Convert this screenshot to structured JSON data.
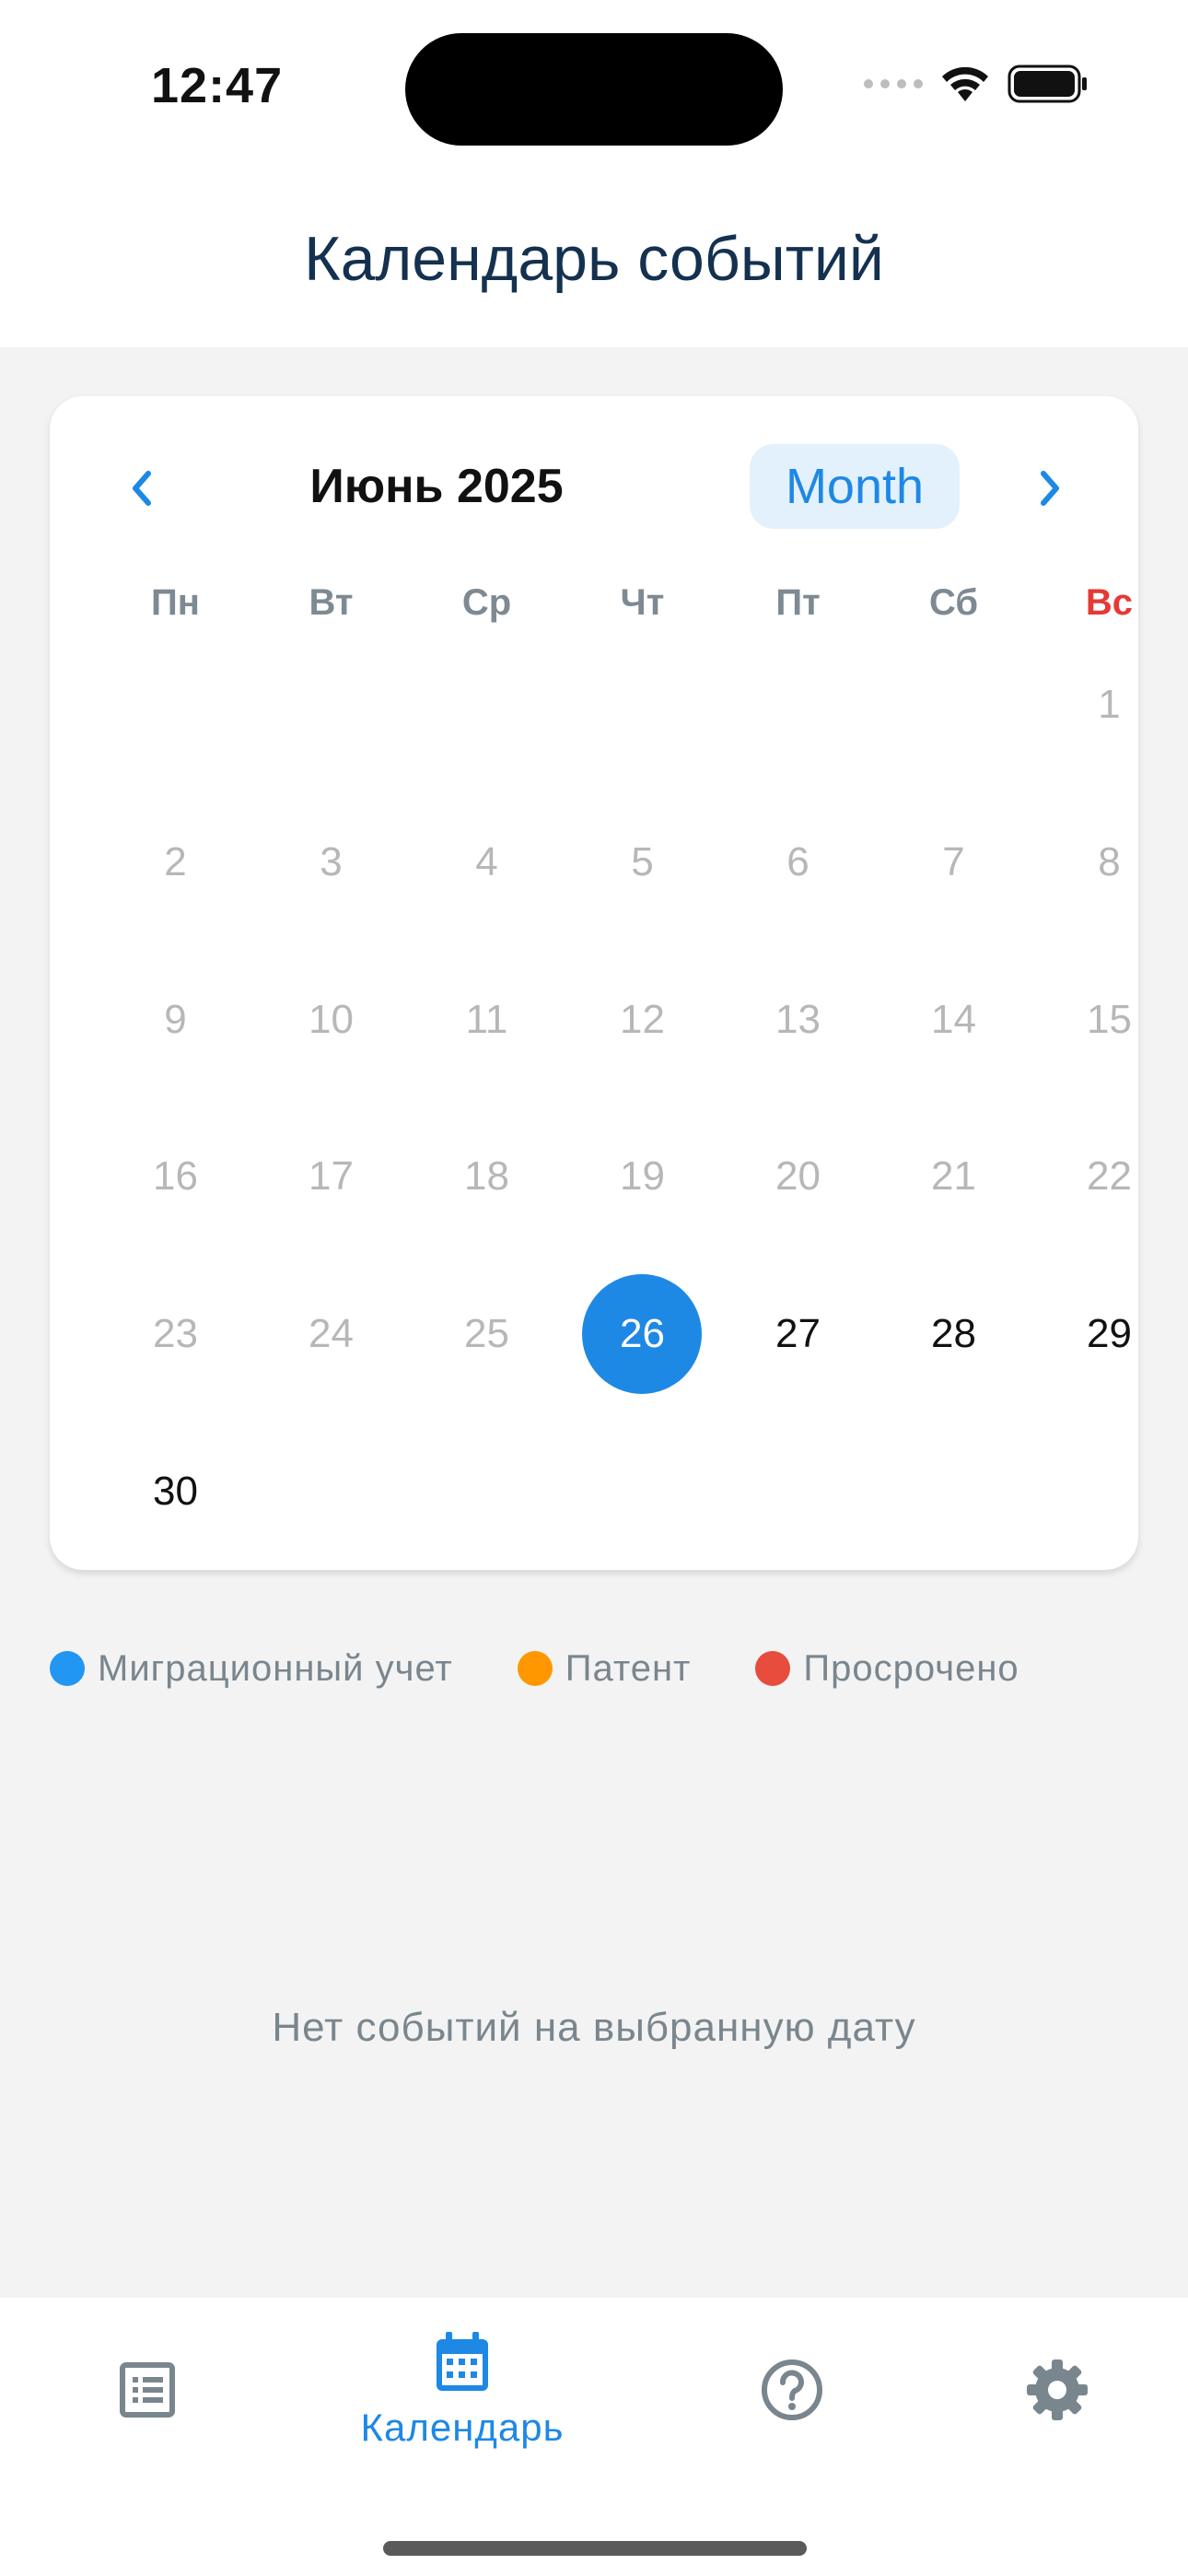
{
  "status_bar": {
    "time": "12:47"
  },
  "header": {
    "title": "Календарь событий"
  },
  "calendar": {
    "month_title": "Июнь 2025",
    "view_button": "Month",
    "weekdays": [
      "Пн",
      "Вт",
      "Ср",
      "Чт",
      "Пт",
      "Сб",
      "Вс"
    ],
    "days": [
      "1",
      "2",
      "3",
      "4",
      "5",
      "6",
      "7",
      "8",
      "9",
      "10",
      "11",
      "12",
      "13",
      "14",
      "15",
      "16",
      "17",
      "18",
      "19",
      "20",
      "21",
      "22",
      "23",
      "24",
      "25",
      "26",
      "27",
      "28",
      "29",
      "30"
    ],
    "selected_day": "26",
    "colors": {
      "accent": "#1e88e5",
      "sunday": "#e53935"
    }
  },
  "legend": [
    {
      "label": "Миграционный учет",
      "color": "#2196f3"
    },
    {
      "label": "Патент",
      "color": "#ff9800"
    },
    {
      "label": "Просрочено",
      "color": "#e74c3c"
    }
  ],
  "events": {
    "empty_message": "Нет событий на выбранную дату"
  },
  "bottom_nav": {
    "tabs": [
      {
        "icon": "list-icon",
        "label": ""
      },
      {
        "icon": "calendar-icon",
        "label": "Календарь"
      },
      {
        "icon": "help-icon",
        "label": ""
      },
      {
        "icon": "gear-icon",
        "label": ""
      }
    ]
  }
}
